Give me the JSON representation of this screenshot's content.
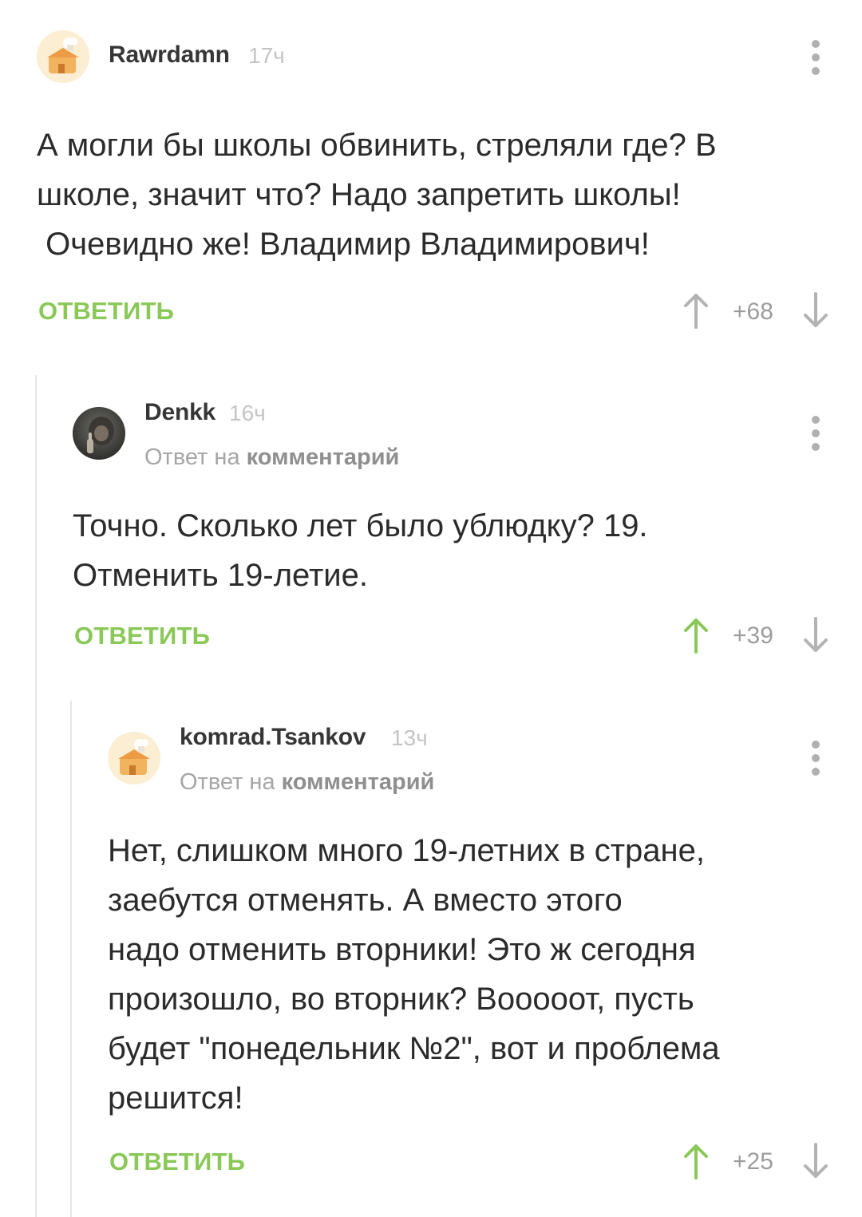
{
  "comments": [
    {
      "author": "Rawrdamn",
      "time": "17ч",
      "avatar": "default-avatar",
      "text_lines": [
        "А могли бы школы обвинить, стреляли где? В",
        "школе, значит что? Надо запретить школы!",
        " Очевидно же! Владимир Владимирович!"
      ],
      "reply_label": "ОТВЕТИТЬ",
      "rating": "+68",
      "upvoted": false
    },
    {
      "author": "Denkk",
      "time": "16ч",
      "avatar": "photo-avatar",
      "reply_prefix": "Ответ на",
      "reply_link": "комментарий",
      "text_lines": [
        "Точно. Сколько лет было ублюдку? 19.",
        "Отменить 19-летие."
      ],
      "reply_label": "ОТВЕТИТЬ",
      "rating": "+39",
      "upvoted": true
    },
    {
      "author": "komrad.Tsankov",
      "time": "13ч",
      "avatar": "default-avatar",
      "reply_prefix": "Ответ на",
      "reply_link": "комментарий",
      "text_lines": [
        "Нет, слишком много 19-летних в стране,",
        "заебутся отменять. А вместо этого",
        "надо отменить вторники! Это ж сегодня",
        "произошло, во вторник? Вооооот, пусть",
        "будет \"понедельник №2\", вот и проблема",
        "решится!"
      ],
      "reply_label": "ОТВЕТИТЬ",
      "rating": "+25",
      "upvoted": true
    }
  ],
  "colors": {
    "accent_green": "#8ac858",
    "arrow_gray": "#b3b3b3",
    "thread_line": "#e6e6e6"
  },
  "icons": {
    "more": "more-vertical-icon",
    "upvote": "arrow-up-icon",
    "downvote": "arrow-down-icon"
  }
}
